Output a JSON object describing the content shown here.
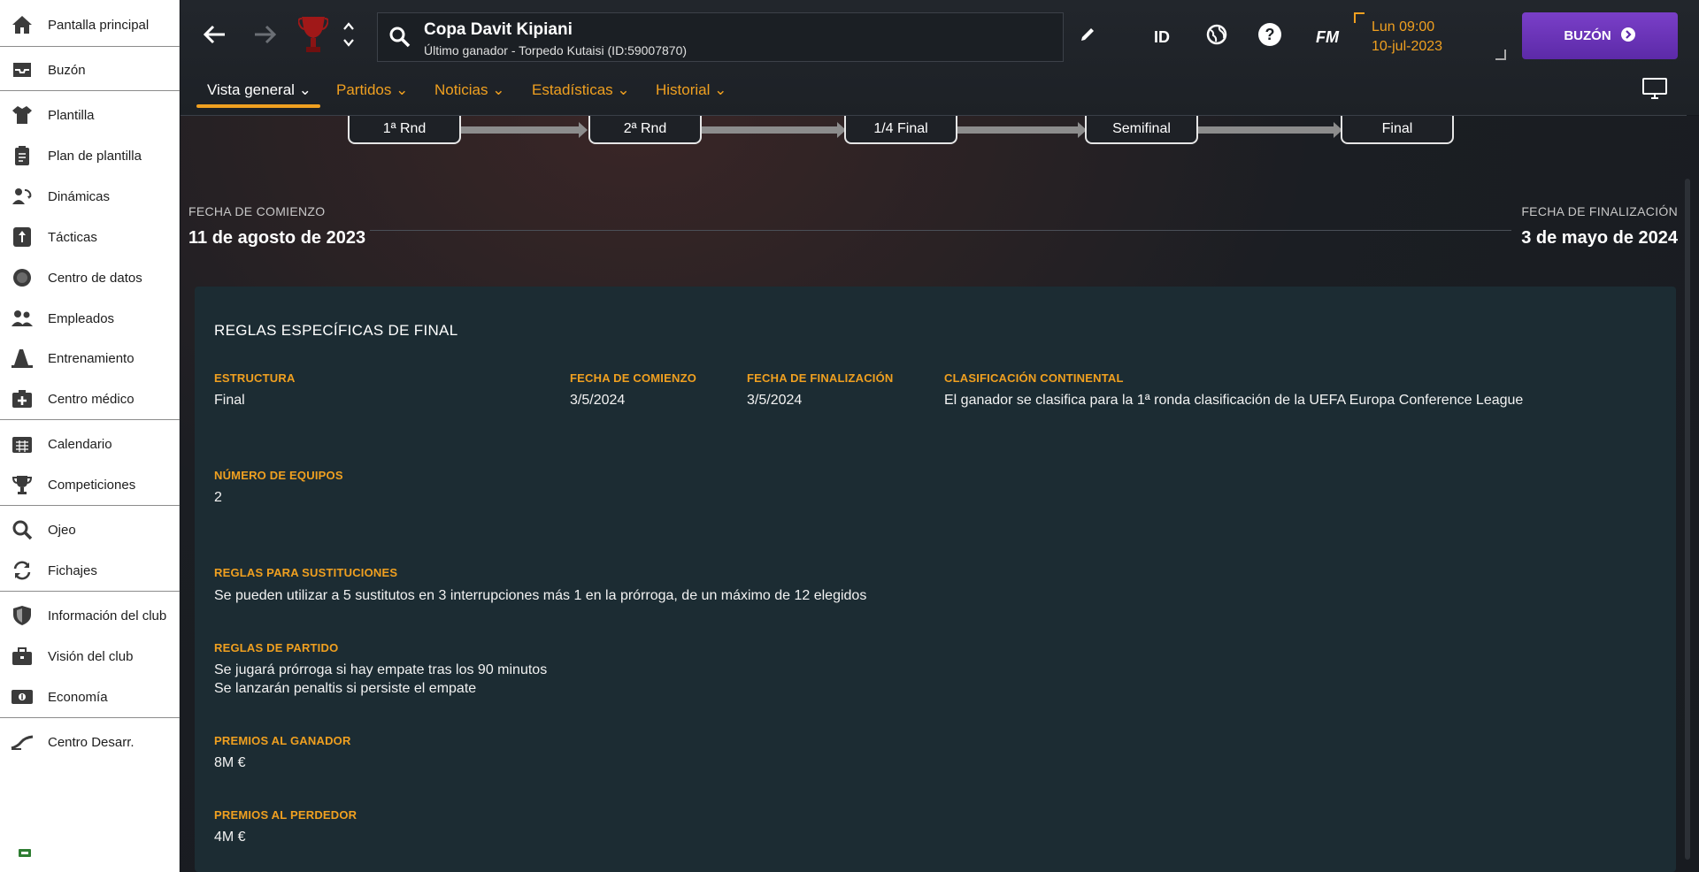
{
  "sidebar": {
    "items": [
      {
        "label": "Pantalla principal",
        "icon": "home-icon"
      },
      {
        "label": "Buzón",
        "icon": "inbox-icon"
      },
      {
        "label": "Plantilla",
        "icon": "shirt-icon"
      },
      {
        "label": "Plan de plantilla",
        "icon": "clipboard-icon"
      },
      {
        "label": "Dinámicas",
        "icon": "dynamics-icon"
      },
      {
        "label": "Tácticas",
        "icon": "tactics-icon"
      },
      {
        "label": "Centro de datos",
        "icon": "data-icon"
      },
      {
        "label": "Empleados",
        "icon": "staff-icon"
      },
      {
        "label": "Entrenamiento",
        "icon": "training-cone-icon"
      },
      {
        "label": "Centro médico",
        "icon": "medical-icon"
      },
      {
        "label": "Calendario",
        "icon": "calendar-icon"
      },
      {
        "label": "Competiciones",
        "icon": "trophy-icon"
      },
      {
        "label": "Ojeo",
        "icon": "search-icon"
      },
      {
        "label": "Fichajes",
        "icon": "transfer-icon"
      },
      {
        "label": "Información del club",
        "icon": "shield-icon"
      },
      {
        "label": "Visión del club",
        "icon": "briefcase-icon"
      },
      {
        "label": "Economía",
        "icon": "money-icon"
      },
      {
        "label": "Centro Desarr.",
        "icon": "growth-icon"
      }
    ]
  },
  "header": {
    "title": "Copa Davit Kipiani",
    "subtitle": "Último ganador - Torpedo Kutaisi (ID:59007870)",
    "id_label": "ID",
    "fm_label": "FM",
    "date_line1": "Lun 09:00",
    "date_line2": "10-jul-2023",
    "inbox_label": "BUZÓN",
    "tabs": [
      {
        "label": "Vista general"
      },
      {
        "label": "Partidos"
      },
      {
        "label": "Noticias"
      },
      {
        "label": "Estadísticas"
      },
      {
        "label": "Historial"
      }
    ]
  },
  "rounds": [
    "1ª Rnd",
    "2ª Rnd",
    "1/4 Final",
    "Semifinal",
    "Final"
  ],
  "dates": {
    "start_caption": "FECHA DE COMIENZO",
    "start_value": "11 de agosto de 2023",
    "end_caption": "FECHA DE FINALIZACIÓN",
    "end_value": "3 de mayo de 2024"
  },
  "rules": {
    "title": "REGLAS ESPECÍFICAS DE FINAL",
    "structure_caption": "ESTRUCTURA",
    "structure_value": "Final",
    "start_caption": "FECHA DE COMIENZO",
    "start_value": "3/5/2024",
    "end_caption": "FECHA DE FINALIZACIÓN",
    "end_value": "3/5/2024",
    "continental_caption": "CLASIFICACIÓN CONTINENTAL",
    "continental_value": "El ganador se clasifica para la 1ª ronda clasificación de la UEFA Europa Conference League",
    "teams_caption": "NÚMERO DE EQUIPOS",
    "teams_value": "2",
    "subs_caption": "REGLAS PARA SUSTITUCIONES",
    "subs_value": "Se pueden utilizar a 5 sustitutos en 3 interrupciones más 1 en la prórroga, de un máximo de 12 elegidos",
    "match_caption": "REGLAS DE PARTIDO",
    "match_line1": "Se jugará prórroga si hay empate tras los 90 minutos",
    "match_line2": "Se lanzarán penaltis si persiste el empate",
    "winner_caption": "PREMIOS AL GANADOR",
    "winner_value": "8M €",
    "loser_caption": "PREMIOS AL PERDEDOR",
    "loser_value": "4M €"
  },
  "colors": {
    "accent": "#f0a020",
    "inbox": "#6a33b8",
    "panel": "#1c2c33"
  }
}
